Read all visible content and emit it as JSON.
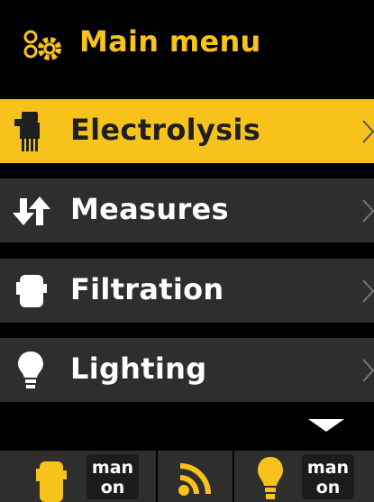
{
  "header": {
    "title": "Main menu",
    "icon": "settings-gears-icon"
  },
  "menu": {
    "items": [
      {
        "label": "Electrolysis",
        "icon": "electrolysis-cell-icon",
        "active": true
      },
      {
        "label": "Measures",
        "icon": "up-down-arrows-icon",
        "active": false
      },
      {
        "label": "Filtration",
        "icon": "pump-icon",
        "active": false
      },
      {
        "label": "Lighting",
        "icon": "light-bulb-icon",
        "active": false
      }
    ],
    "more_indicator": "scroll-down-arrow-icon"
  },
  "statusbar": {
    "pump": {
      "icon": "pump-icon",
      "mode": "man",
      "state": "on"
    },
    "network": {
      "icon": "wifi-signal-icon"
    },
    "light": {
      "icon": "light-bulb-icon",
      "mode": "man",
      "state": "on"
    }
  },
  "colors": {
    "accent": "#f8c21c",
    "item_bg": "#2e2f2c",
    "background": "#000000"
  }
}
